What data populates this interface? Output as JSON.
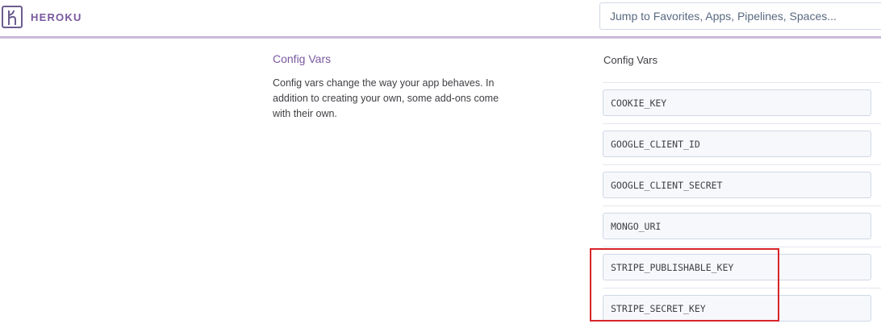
{
  "header": {
    "brand": "HEROKU",
    "logo_icon": "heroku-logo-icon",
    "search_placeholder": "Jump to Favorites, Apps, Pipelines, Spaces..."
  },
  "section": {
    "title": "Config Vars",
    "description": "Config vars change the way your app behaves. In addition to creating your own, some add-ons come with their own."
  },
  "config_vars": {
    "heading": "Config Vars",
    "keys": [
      "COOKIE_KEY",
      "GOOGLE_CLIENT_ID",
      "GOOGLE_CLIENT_SECRET",
      "MONGO_URI",
      "STRIPE_PUBLISHABLE_KEY",
      "STRIPE_SECRET_KEY"
    ]
  },
  "annotation": {
    "color": "#d8242b"
  },
  "colors": {
    "brand": "#79589f",
    "text": "#3f3f44"
  }
}
